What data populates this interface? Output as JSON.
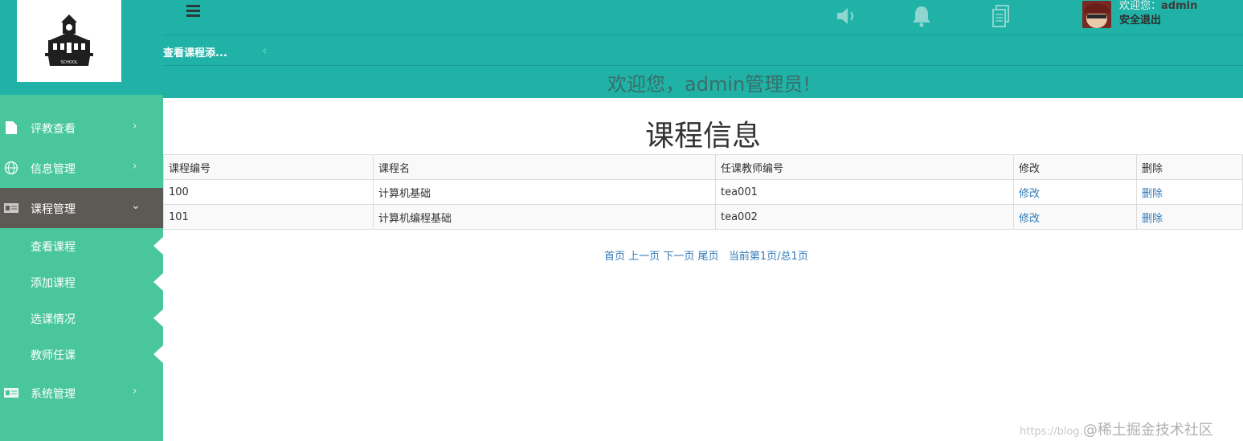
{
  "header": {
    "welcome_prefix": "欢迎您：",
    "username": "admin",
    "logout": "安全退出",
    "tab_label": "查看课程添...",
    "tab_back": "‹",
    "banner": "欢迎您，admin管理员!",
    "logo_text": "SCHOOL"
  },
  "sidebar": {
    "items": [
      {
        "label": "评教查看",
        "icon": "file-icon"
      },
      {
        "label": "信息管理",
        "icon": "globe-icon"
      },
      {
        "label": "课程管理",
        "icon": "id-card-icon"
      },
      {
        "label": "系统管理",
        "icon": "id-card-icon"
      }
    ],
    "sub_items": [
      {
        "label": "查看课程"
      },
      {
        "label": "添加课程"
      },
      {
        "label": "选课情况"
      },
      {
        "label": "教师任课"
      }
    ]
  },
  "main": {
    "title": "课程信息",
    "columns": [
      "课程编号",
      "课程名",
      "任课教师编号",
      "修改",
      "删除"
    ],
    "rows": [
      {
        "id": "100",
        "name": "计算机基础",
        "teacher": "tea001",
        "edit": "修改",
        "delete": "删除"
      },
      {
        "id": "101",
        "name": "计算机编程基础",
        "teacher": "tea002",
        "edit": "修改",
        "delete": "删除"
      }
    ],
    "pager": {
      "first": "首页",
      "prev": "上一页",
      "next": "下一页",
      "last": "尾页",
      "info": "当前第1页/总1页"
    }
  },
  "watermark": {
    "url": "https://blog.",
    "brand": "@稀土掘金技术社区"
  },
  "colors": {
    "header": "#20b2a6",
    "sidebar": "#4ac69d",
    "sidebar_active": "#5d5a55",
    "link": "#337ab7"
  }
}
